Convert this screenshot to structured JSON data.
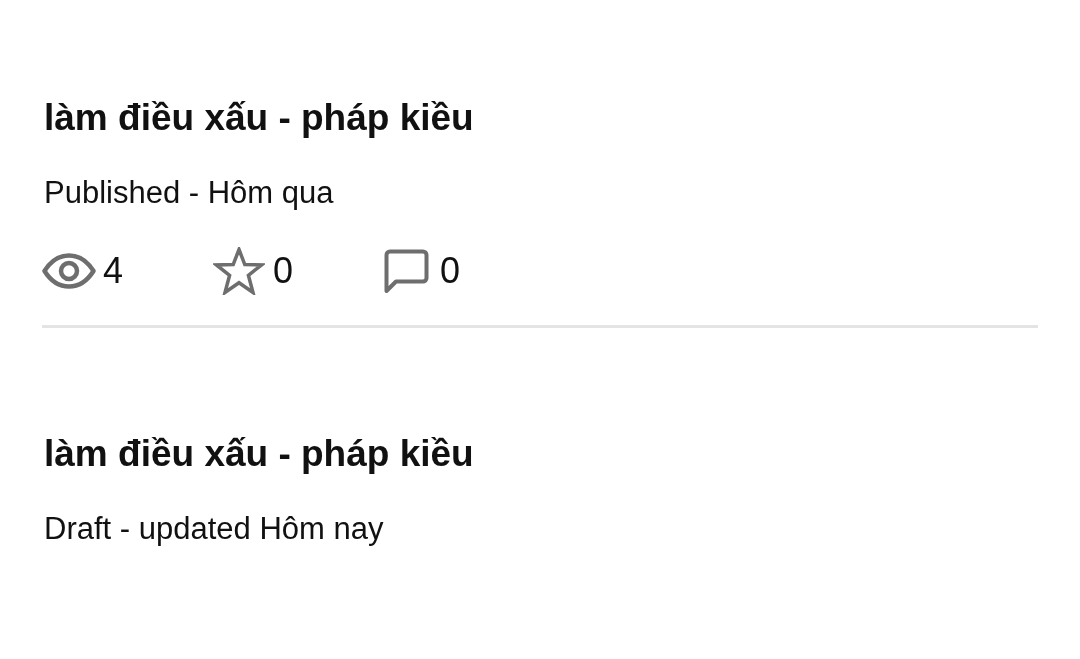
{
  "posts": [
    {
      "title": "làm điều xấu - pháp kiều",
      "status": "Published - Hôm qua",
      "stats": [
        {
          "kind": "views",
          "count": "4"
        },
        {
          "kind": "stars",
          "count": "0"
        },
        {
          "kind": "comments",
          "count": "0"
        }
      ]
    },
    {
      "title": "làm điều xấu - pháp kiều",
      "status": "Draft - updated Hôm nay"
    }
  ]
}
